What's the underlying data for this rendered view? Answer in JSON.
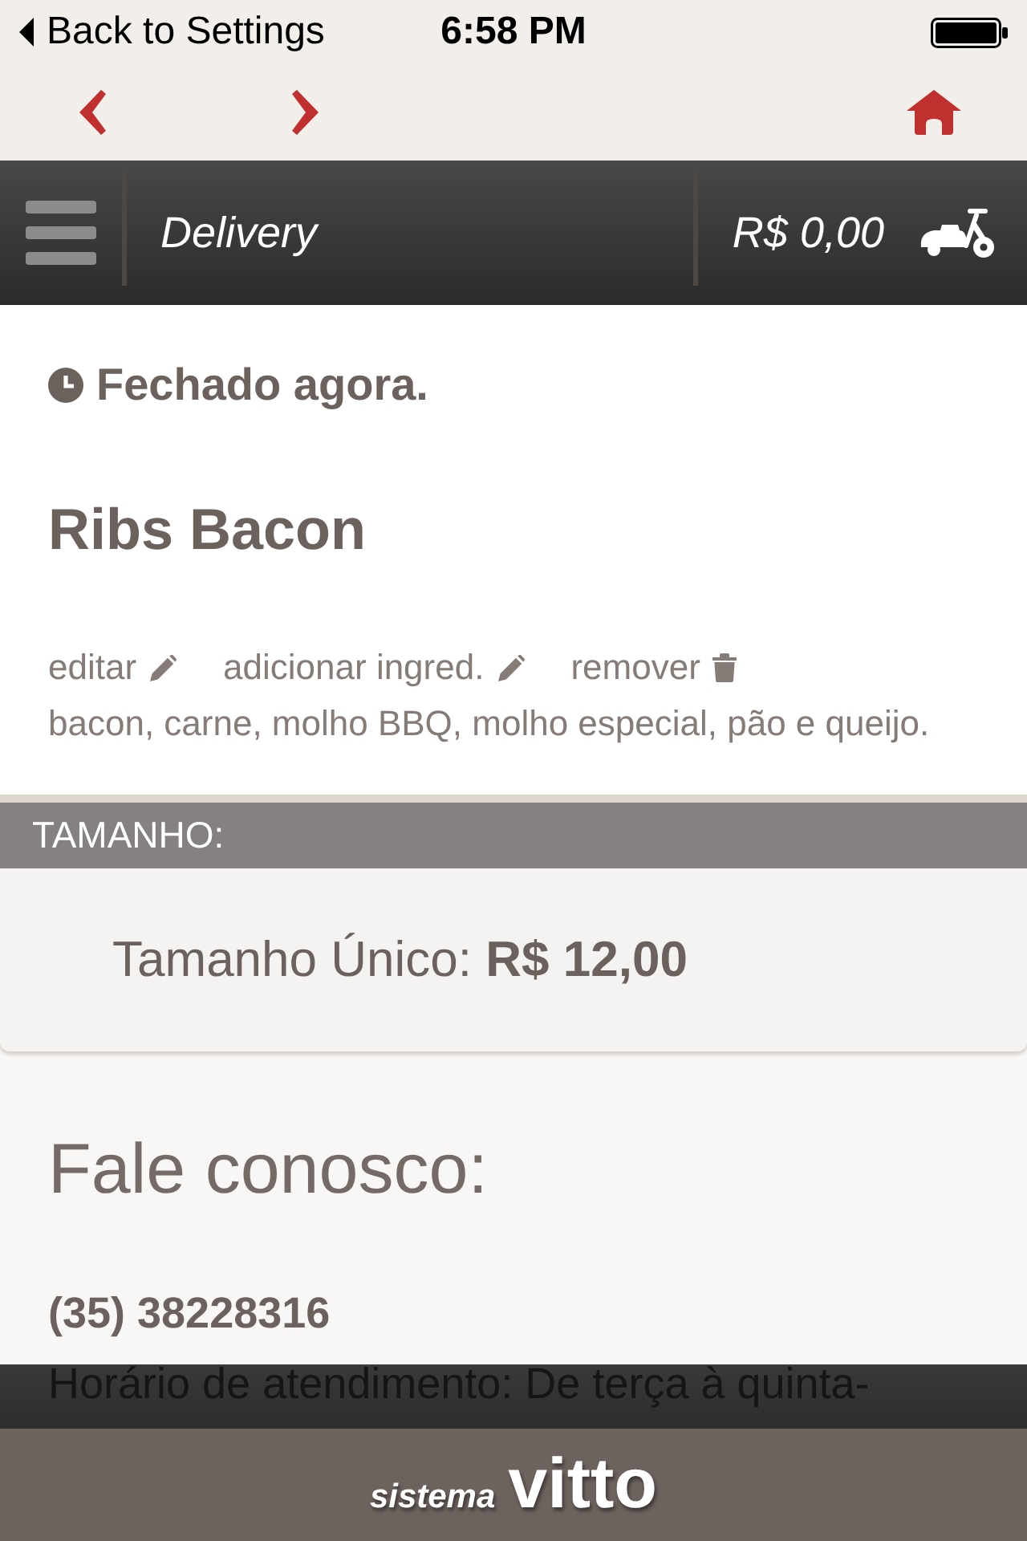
{
  "status_bar": {
    "back_label": "Back to Settings",
    "time": "6:58 PM"
  },
  "header": {
    "title": "Delivery",
    "cart_total": "R$ 0,00"
  },
  "store_status": {
    "text": "Fechado agora."
  },
  "product": {
    "name": "Ribs Bacon",
    "actions": [
      {
        "label": "editar",
        "kind": "edit"
      },
      {
        "label": "adicionar ingred.",
        "kind": "edit"
      },
      {
        "label": "remover",
        "kind": "delete"
      }
    ],
    "ingredients": "bacon, carne, molho BBQ, molho especial, pão e queijo."
  },
  "size_section": {
    "title": "TAMANHO:",
    "options": [
      {
        "text": "Tamanho Único: **R$ 12,00**"
      }
    ]
  },
  "contact": {
    "title": "Fale conosco:",
    "phone": "(35) 38228316",
    "hours": "Horário de atendimento: De terça à quinta-"
  },
  "footer": {
    "logo_prefix": "sistema",
    "logo_name": "vitto"
  }
}
